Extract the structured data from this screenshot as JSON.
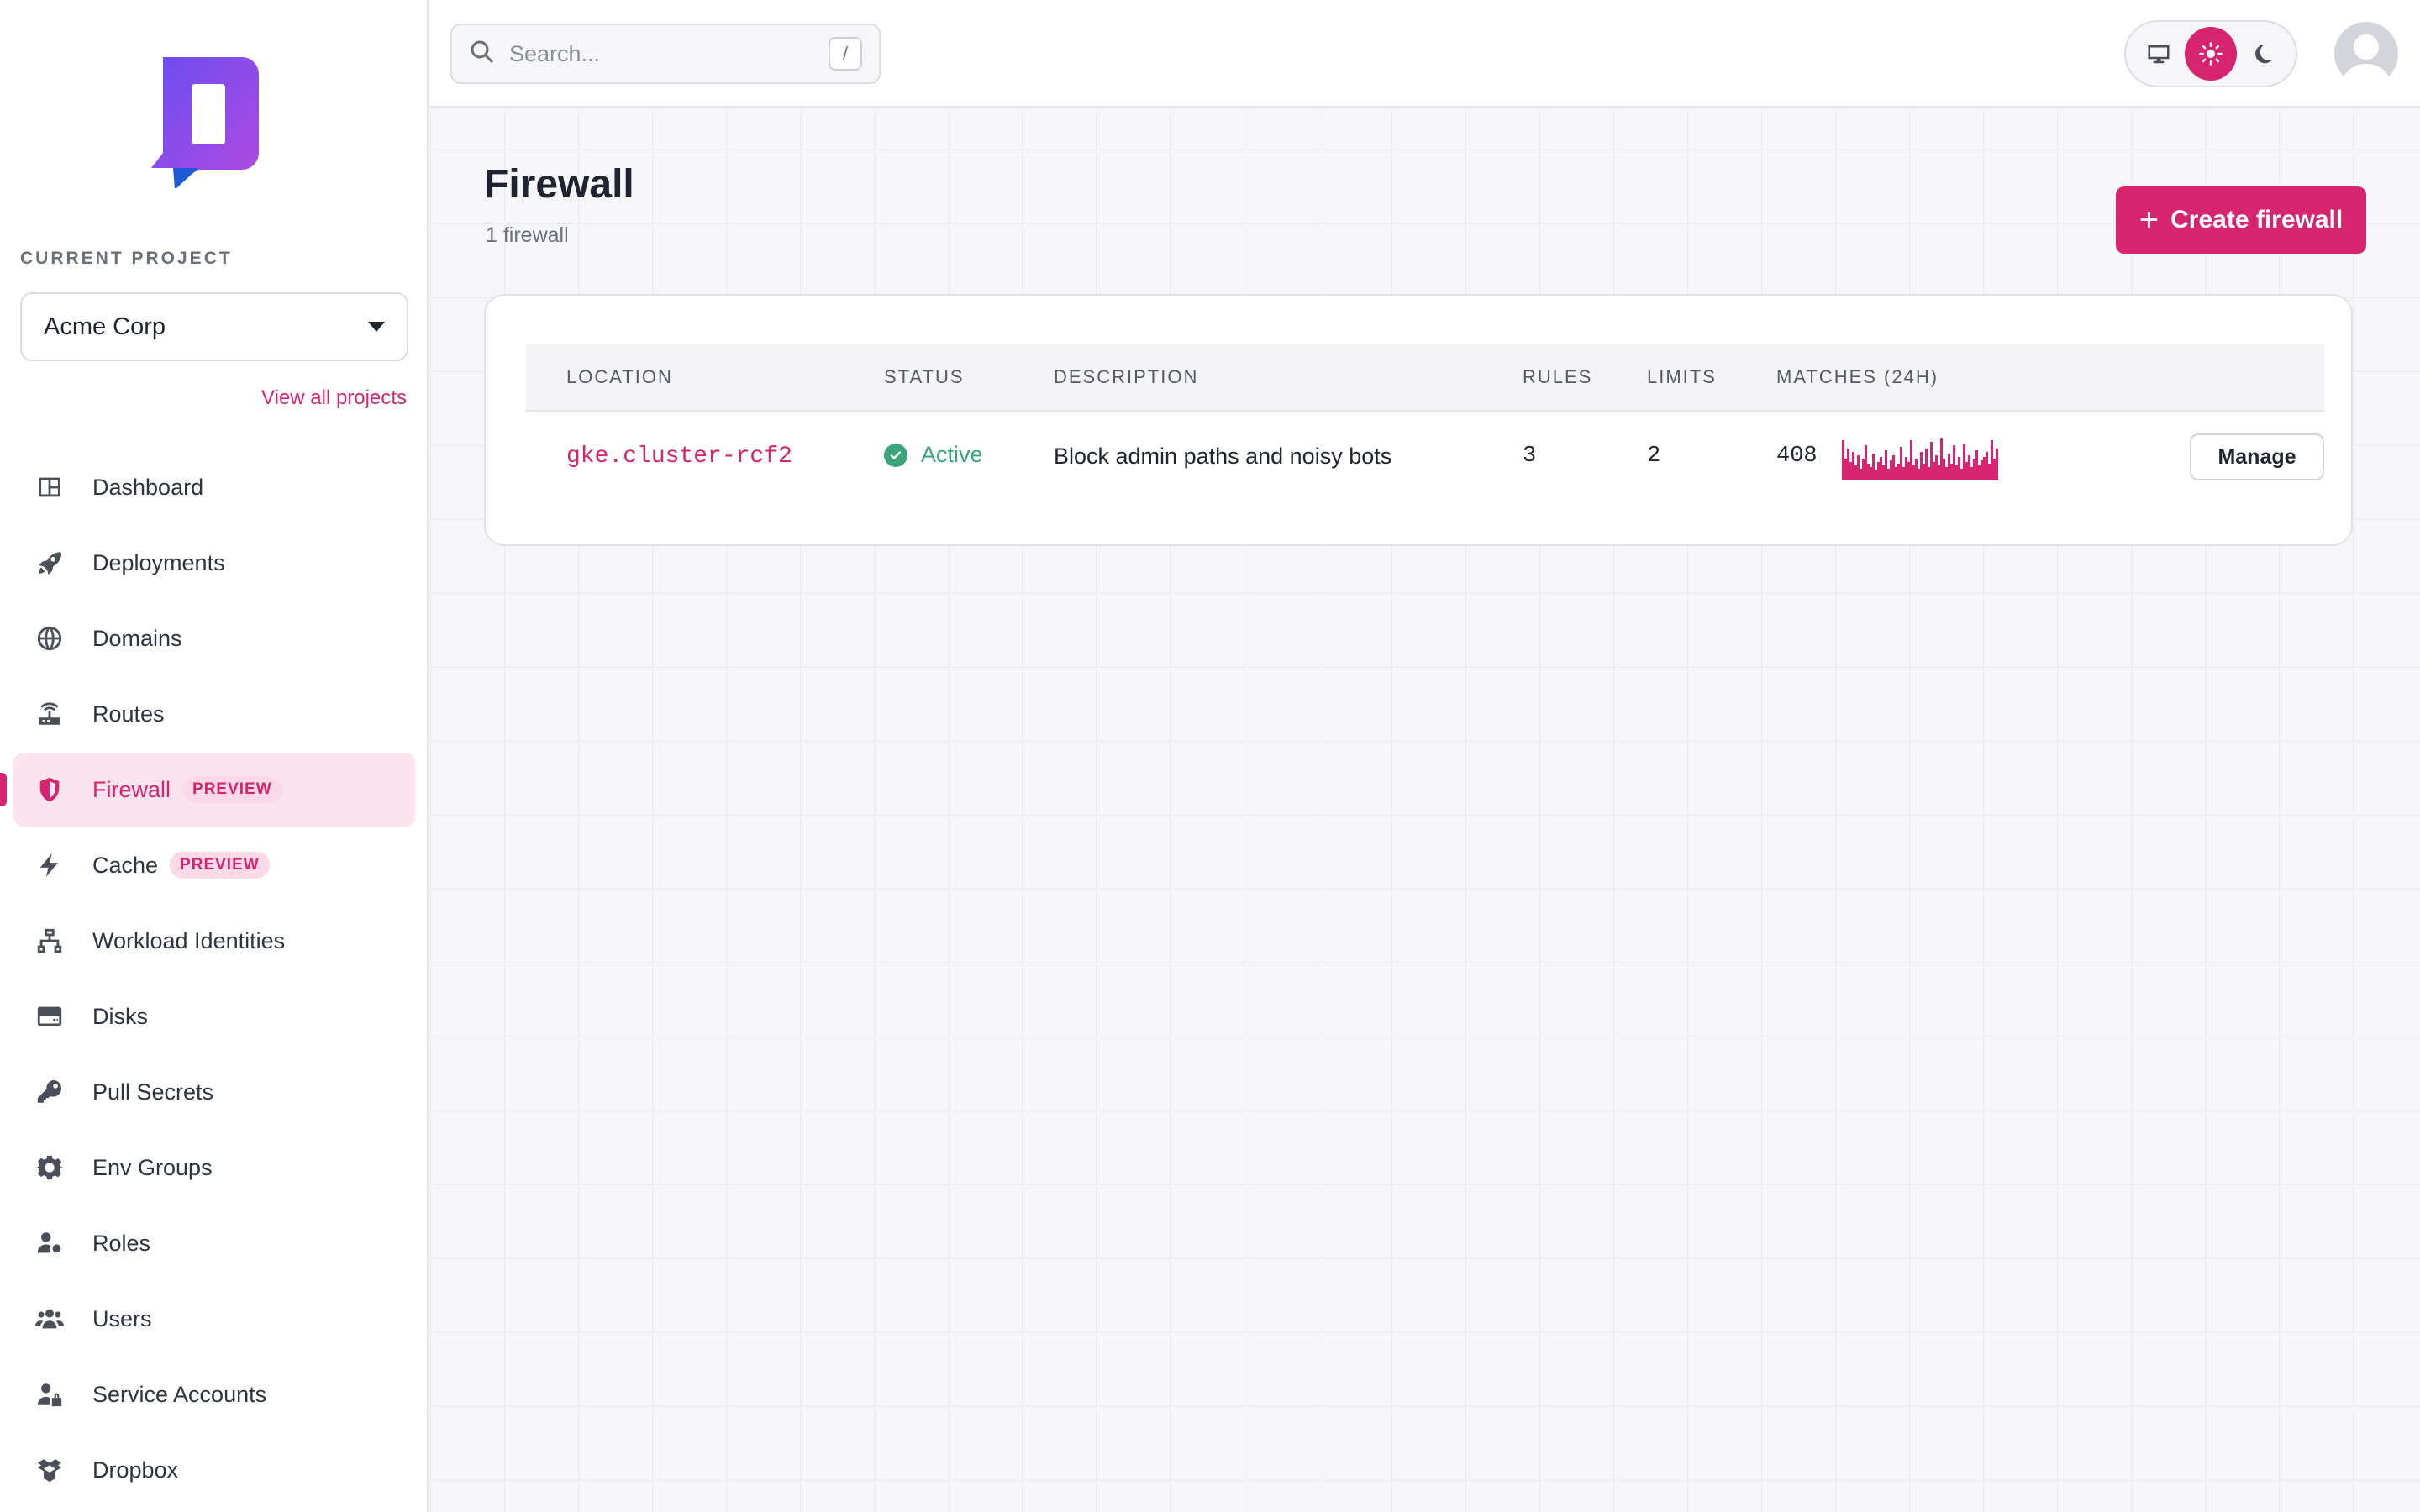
{
  "sidebar": {
    "current_project_label": "CURRENT PROJECT",
    "current_project": "Acme Corp",
    "view_all_projects": "View all projects",
    "items": [
      {
        "label": "Dashboard",
        "icon": "dashboard-icon"
      },
      {
        "label": "Deployments",
        "icon": "rocket-icon"
      },
      {
        "label": "Domains",
        "icon": "globe-icon"
      },
      {
        "label": "Routes",
        "icon": "router-icon"
      },
      {
        "label": "Firewall",
        "icon": "shield-icon",
        "badge": "PREVIEW",
        "active": true
      },
      {
        "label": "Cache",
        "icon": "bolt-icon",
        "badge": "PREVIEW"
      },
      {
        "label": "Workload Identities",
        "icon": "network-icon"
      },
      {
        "label": "Disks",
        "icon": "disk-icon"
      },
      {
        "label": "Pull Secrets",
        "icon": "key-icon"
      },
      {
        "label": "Env Groups",
        "icon": "gear-icon"
      },
      {
        "label": "Roles",
        "icon": "user-gear-icon"
      },
      {
        "label": "Users",
        "icon": "users-icon"
      },
      {
        "label": "Service Accounts",
        "icon": "user-lock-icon"
      },
      {
        "label": "Dropbox",
        "icon": "box-icon"
      }
    ]
  },
  "topbar": {
    "search_placeholder": "Search...",
    "search_shortcut": "/",
    "theme_options": [
      "system-icon",
      "sun-icon",
      "moon-icon"
    ],
    "theme_selected": "light"
  },
  "main": {
    "title": "Firewall",
    "subtitle": "1 firewall",
    "create_button": "Create firewall",
    "table": {
      "headers": [
        "LOCATION",
        "STATUS",
        "DESCRIPTION",
        "RULES",
        "LIMITS",
        "MATCHES (24H)"
      ],
      "rows": [
        {
          "location": "gke.cluster-rcf2",
          "status": "Active",
          "description": "Block admin paths and noisy bots",
          "rules": "3",
          "limits": "2",
          "matches": "408",
          "action": "Manage"
        }
      ]
    }
  },
  "colors": {
    "accent": "#d6246e",
    "status_active": "#3aa47a"
  }
}
